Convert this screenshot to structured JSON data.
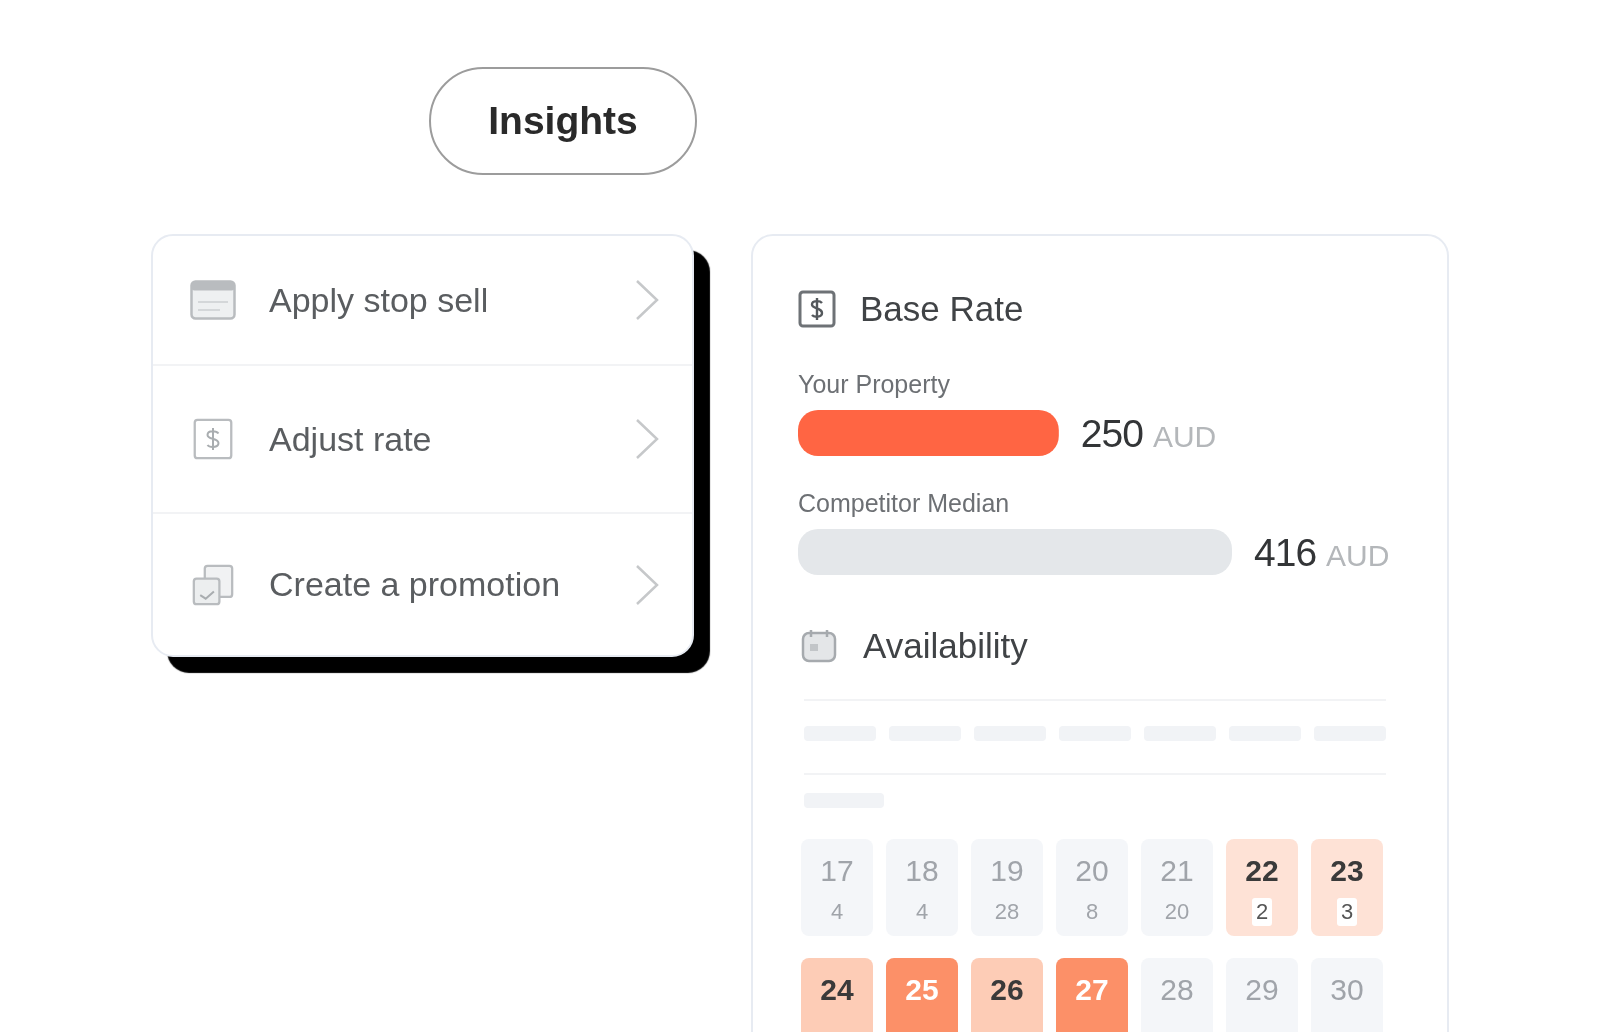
{
  "header": {
    "button": "Insights"
  },
  "actions": [
    {
      "kind": "stopsell",
      "label": "Apply stop sell"
    },
    {
      "kind": "rate",
      "label": "Adjust rate"
    },
    {
      "kind": "promotion",
      "label": "Create a promotion"
    }
  ],
  "base_rate": {
    "title": "Base Rate",
    "chart_data": {
      "type": "bar",
      "orientation": "horizontal",
      "categories": [
        "Your Property",
        "Competitor Median"
      ],
      "series": [
        {
          "color": "#ff6543",
          "values": [
            250,
            null
          ]
        },
        {
          "color": "#e4e7ea",
          "values": [
            null,
            416
          ]
        }
      ],
      "data_labels": true
    },
    "value_units": [
      "AUD",
      "AUD"
    ]
  },
  "availability": {
    "title": "Availability",
    "weeks": [
      {
        "days": [
          {
            "day": "17",
            "count": "4",
            "highlighted": false,
            "color": "#f4f6f9"
          },
          {
            "day": "18",
            "count": "4",
            "highlighted": false,
            "color": "#f4f6f9"
          },
          {
            "day": "19",
            "count": "28",
            "highlighted": false,
            "color": "#f4f6f9"
          },
          {
            "day": "20",
            "count": "8",
            "highlighted": false,
            "color": "#f4f6f9"
          },
          {
            "day": "21",
            "count": "20",
            "highlighted": false,
            "color": "#f4f6f9"
          },
          {
            "day": "22",
            "count": "2",
            "highlighted": true,
            "color": "#fee2d6"
          },
          {
            "day": "23",
            "count": "3",
            "highlighted": true,
            "color": "#fee2d6"
          }
        ]
      },
      {
        "days": [
          {
            "day": "24",
            "highlighted": true,
            "color": "#fdccb6"
          },
          {
            "day": "25",
            "highlighted": true,
            "color": "#fc9068"
          },
          {
            "day": "26",
            "highlighted": true,
            "color": "#fdccb6"
          },
          {
            "day": "27",
            "highlighted": true,
            "color": "#fc9068"
          },
          {
            "day": "28",
            "highlighted": false,
            "color": "#f4f6f9"
          },
          {
            "day": "29",
            "highlighted": false,
            "color": "#f4f6f9"
          },
          {
            "day": "30",
            "highlighted": false,
            "color": "#f4f6f9"
          }
        ]
      }
    ]
  }
}
